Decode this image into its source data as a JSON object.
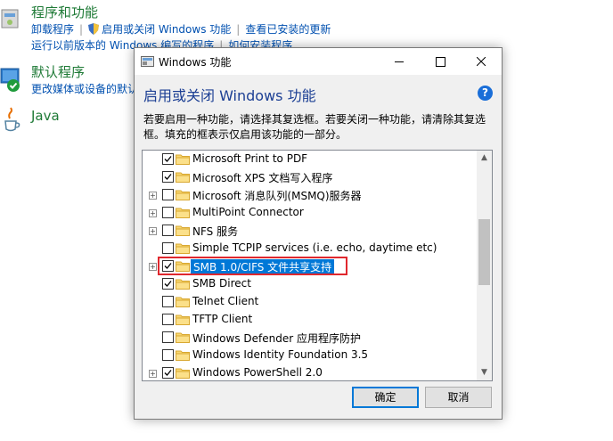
{
  "control_panel": {
    "programs": {
      "title": "程序和功能",
      "links_row1": [
        "卸载程序",
        "启用或关闭 Windows 功能",
        "查看已安装的更新"
      ],
      "links_row2": [
        "运行以前版本的 Windows 编写的程序",
        "如何安装程序"
      ]
    },
    "default_programs": {
      "title": "默认程序",
      "link": "更改媒体或设备的默认设置"
    },
    "java": {
      "title": "Java"
    }
  },
  "dialog": {
    "window_title": "Windows 功能",
    "heading": "启用或关闭 Windows 功能",
    "help_glyph": "?",
    "description": "若要启用一种功能，请选择其复选框。若要关闭一种功能，请清除其复选框。填充的框表示仅启用该功能的一部分。",
    "features": [
      {
        "label": "Microsoft Print to PDF",
        "checked": true,
        "expandable": false,
        "selected": false
      },
      {
        "label": "Microsoft XPS 文档写入程序",
        "checked": true,
        "expandable": false,
        "selected": false
      },
      {
        "label": "Microsoft 消息队列(MSMQ)服务器",
        "checked": false,
        "expandable": true,
        "selected": false
      },
      {
        "label": "MultiPoint Connector",
        "checked": false,
        "expandable": true,
        "selected": false
      },
      {
        "label": "NFS 服务",
        "checked": false,
        "expandable": true,
        "selected": false
      },
      {
        "label": "Simple TCPIP services (i.e. echo, daytime etc)",
        "checked": false,
        "expandable": false,
        "selected": false
      },
      {
        "label": "SMB 1.0/CIFS 文件共享支持",
        "checked": true,
        "expandable": true,
        "selected": true
      },
      {
        "label": "SMB Direct",
        "checked": true,
        "expandable": false,
        "selected": false
      },
      {
        "label": "Telnet Client",
        "checked": false,
        "expandable": false,
        "selected": false
      },
      {
        "label": "TFTP Client",
        "checked": false,
        "expandable": false,
        "selected": false
      },
      {
        "label": "Windows Defender 应用程序防护",
        "checked": false,
        "expandable": false,
        "selected": false
      },
      {
        "label": "Windows Identity Foundation 3.5",
        "checked": false,
        "expandable": false,
        "selected": false
      },
      {
        "label": "Windows PowerShell 2.0",
        "checked": true,
        "expandable": true,
        "selected": false
      }
    ],
    "ok_label": "确定",
    "cancel_label": "取消"
  },
  "colors": {
    "heading": "#1c3f94",
    "link": "#0050b0",
    "section_title": "#1e7a36",
    "selection": "#0078d7",
    "highlight_box": "#e0282e"
  },
  "icons": [
    "programs-icon",
    "shield-icon",
    "default-programs-icon",
    "check-badge-icon",
    "java-icon",
    "windows-features-icon",
    "help-icon",
    "folder-icon",
    "checkbox-check-icon",
    "expand-plus-icon"
  ]
}
